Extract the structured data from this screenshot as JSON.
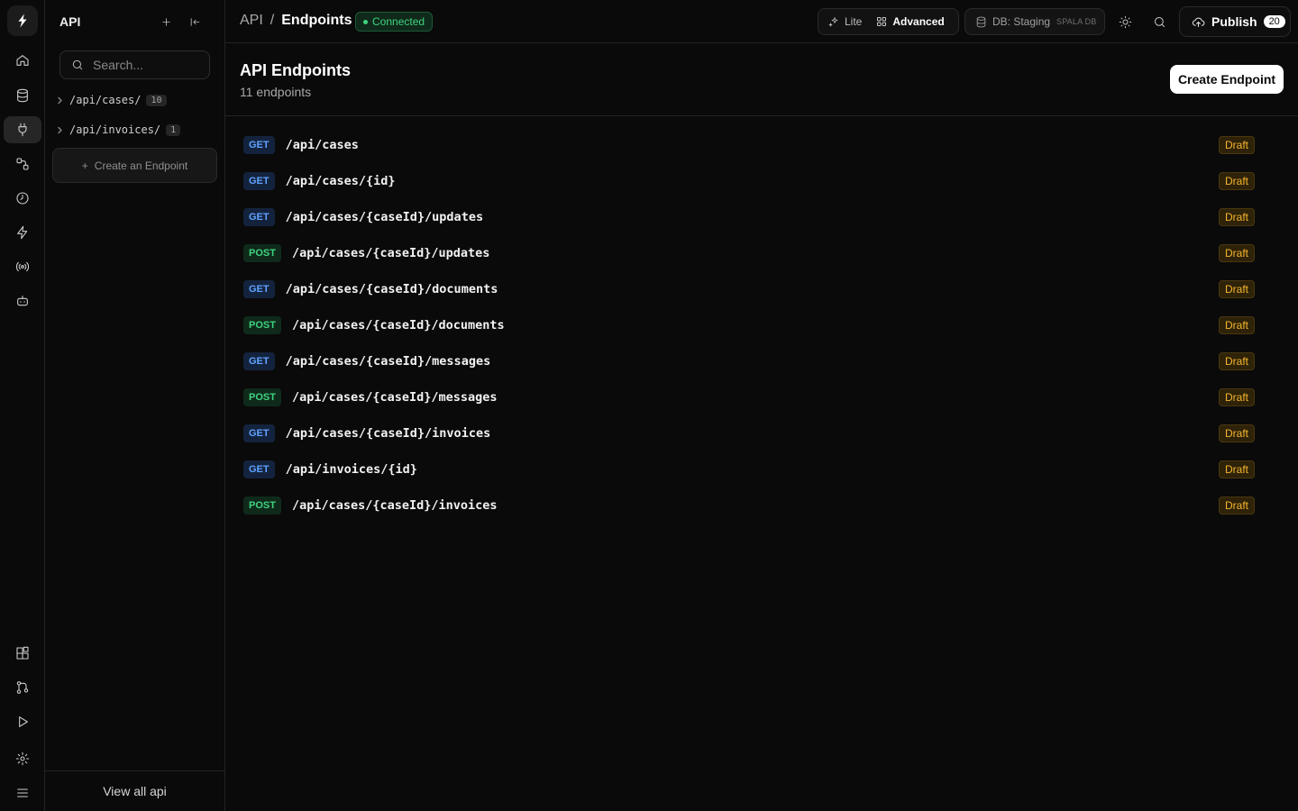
{
  "rail": {
    "items": [
      {
        "name": "home-icon"
      },
      {
        "name": "database-icon"
      },
      {
        "name": "plug-icon",
        "active": true
      },
      {
        "name": "workflow-icon"
      },
      {
        "name": "clock-icon"
      },
      {
        "name": "bolt-icon"
      },
      {
        "name": "broadcast-icon"
      },
      {
        "name": "bot-icon"
      }
    ],
    "bottom": [
      {
        "name": "integrations-icon"
      },
      {
        "name": "git-icon"
      },
      {
        "name": "play-icon"
      },
      {
        "name": "settings-icon"
      },
      {
        "name": "menu-icon"
      }
    ]
  },
  "sidebar": {
    "title": "API",
    "search_placeholder": "Search...",
    "groups": [
      {
        "path": "/api/cases/",
        "count": "10"
      },
      {
        "path": "/api/invoices/",
        "count": "1"
      }
    ],
    "create_label": "Create an Endpoint",
    "view_all_label": "View all api"
  },
  "header": {
    "crumb_parent": "API",
    "crumb_sep": "/",
    "crumb_current": "Endpoints",
    "connection_status": "Connected",
    "mode_lite": "Lite",
    "mode_advanced": "Advanced",
    "db_label": "DB: Staging",
    "db_sub": "SPALA DB",
    "publish_label": "Publish",
    "publish_count": "20"
  },
  "main": {
    "title": "API Endpoints",
    "subtitle": "11 endpoints",
    "create_button": "Create Endpoint",
    "endpoints": [
      {
        "method": "GET",
        "path": "/api/cases",
        "status": "Draft"
      },
      {
        "method": "GET",
        "path": "/api/cases/{id}",
        "status": "Draft"
      },
      {
        "method": "GET",
        "path": "/api/cases/{caseId}/updates",
        "status": "Draft"
      },
      {
        "method": "POST",
        "path": "/api/cases/{caseId}/updates",
        "status": "Draft"
      },
      {
        "method": "GET",
        "path": "/api/cases/{caseId}/documents",
        "status": "Draft"
      },
      {
        "method": "POST",
        "path": "/api/cases/{caseId}/documents",
        "status": "Draft"
      },
      {
        "method": "GET",
        "path": "/api/cases/{caseId}/messages",
        "status": "Draft"
      },
      {
        "method": "POST",
        "path": "/api/cases/{caseId}/messages",
        "status": "Draft"
      },
      {
        "method": "GET",
        "path": "/api/cases/{caseId}/invoices",
        "status": "Draft"
      },
      {
        "method": "GET",
        "path": "/api/invoices/{id}",
        "status": "Draft"
      },
      {
        "method": "POST",
        "path": "/api/cases/{caseId}/invoices",
        "status": "Draft"
      }
    ]
  },
  "colors": {
    "background": "#0a0a0a",
    "get_method": "#5fa2ff",
    "post_method": "#3fd37e",
    "draft_status": "#f5b52e",
    "connected": "#3fd37e"
  }
}
